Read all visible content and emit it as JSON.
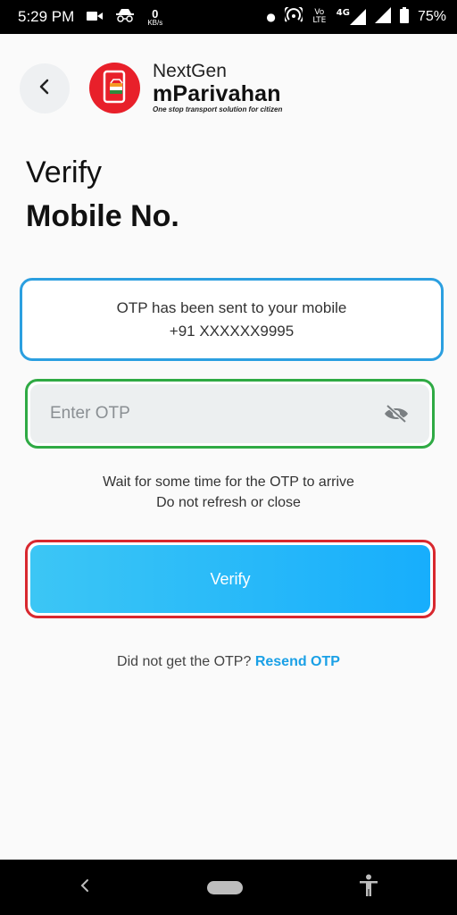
{
  "status_bar": {
    "time": "5:29 PM",
    "net_speed_value": "0",
    "net_speed_unit": "KB/s",
    "volte": "Vo LTE",
    "network_type": "4G",
    "battery": "75%"
  },
  "header": {
    "brand_top": "NextGen",
    "brand_main": "mParivahan",
    "brand_tagline": "One stop transport solution for citizen"
  },
  "title": {
    "line1": "Verify",
    "line2": "Mobile No."
  },
  "otp_info": {
    "line1": "OTP has been sent to your mobile",
    "line2": "+91 XXXXXX9995"
  },
  "otp_input": {
    "placeholder": "Enter OTP",
    "value": ""
  },
  "notes": {
    "line1": "Wait for some time for the OTP to arrive",
    "line2": "Do not refresh or close"
  },
  "verify_button": {
    "label": "Verify"
  },
  "resend": {
    "prompt": "Did not get the OTP?",
    "link": "Resend OTP"
  },
  "colors": {
    "accent": "#1aa0e6",
    "card_border": "#2b9fe0",
    "input_border": "#2faa44",
    "button_border": "#d8282f",
    "logo_red": "#e8202a"
  }
}
